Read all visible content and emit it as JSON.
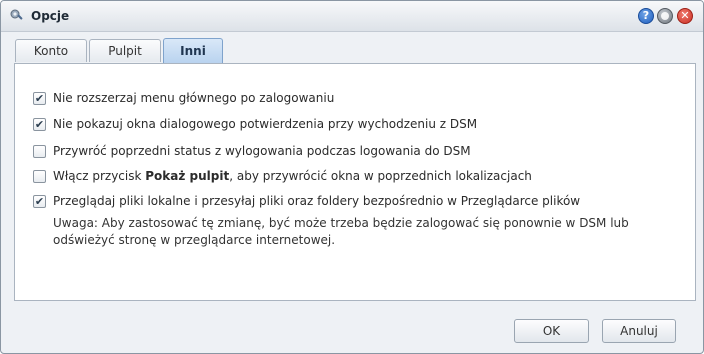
{
  "window": {
    "title": "Opcje"
  },
  "tabs": [
    {
      "label": "Konto"
    },
    {
      "label": "Pulpit"
    },
    {
      "label": "Inni"
    }
  ],
  "options": [
    {
      "label": "Nie rozszerzaj menu głównego po zalogowaniu",
      "checked": true
    },
    {
      "label": "Nie pokazuj okna dialogowego potwierdzenia przy wychodzeniu z DSM",
      "checked": true
    },
    {
      "label": "Przywróć poprzedni status z wylogowania podczas logowania do DSM",
      "checked": false
    },
    {
      "label_pre": "Włącz przycisk ",
      "label_bold": "Pokaż pulpit",
      "label_post": ", aby przywrócić okna w poprzednich lokalizacjach",
      "checked": false
    },
    {
      "label": "Przeglądaj pliki lokalne i przesyłaj pliki oraz foldery bezpośrednio w Przeglądarce plików",
      "checked": true
    }
  ],
  "note": "Uwaga: Aby zastosować tę zmianę, być może trzeba będzie zalogować się ponownie w DSM lub odświeżyć stronę w przeglądarce internetowej.",
  "buttons": {
    "ok": "OK",
    "cancel": "Anuluj"
  },
  "icons": {
    "app": "options-icon",
    "help": "help-icon",
    "minimize": "minimize-icon",
    "close": "close-icon"
  }
}
